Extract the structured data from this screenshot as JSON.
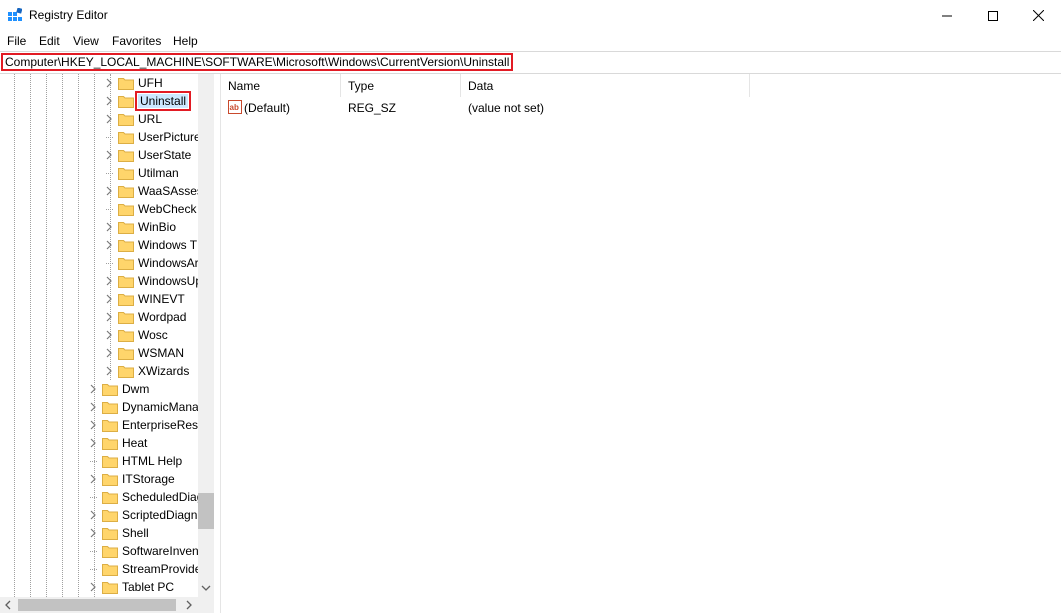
{
  "window": {
    "title": "Registry Editor",
    "controls": {
      "minimize": "minimize-icon",
      "maximize": "maximize-icon",
      "close": "close-icon"
    }
  },
  "menu": [
    "File",
    "Edit",
    "View",
    "Favorites",
    "Help"
  ],
  "address": "Computer\\HKEY_LOCAL_MACHINE\\SOFTWARE\\Microsoft\\Windows\\CurrentVersion\\Uninstall",
  "tree": {
    "deep_nodes": [
      {
        "label": "UFH",
        "expandable": true
      },
      {
        "label": "Uninstall",
        "expandable": true,
        "selected": true
      },
      {
        "label": "URL",
        "expandable": true
      },
      {
        "label": "UserPicture",
        "expandable": false
      },
      {
        "label": "UserState",
        "expandable": true
      },
      {
        "label": "Utilman",
        "expandable": false
      },
      {
        "label": "WaaSAsses",
        "expandable": true
      },
      {
        "label": "WebCheck",
        "expandable": false
      },
      {
        "label": "WinBio",
        "expandable": true
      },
      {
        "label": "Windows T",
        "expandable": true
      },
      {
        "label": "WindowsAr",
        "expandable": false
      },
      {
        "label": "WindowsUp",
        "expandable": true
      },
      {
        "label": "WINEVT",
        "expandable": true
      },
      {
        "label": "Wordpad",
        "expandable": true
      },
      {
        "label": "Wosc",
        "expandable": true
      },
      {
        "label": "WSMAN",
        "expandable": true
      },
      {
        "label": "XWizards",
        "expandable": true
      }
    ],
    "shallow_nodes": [
      {
        "label": "Dwm",
        "expandable": true
      },
      {
        "label": "DynamicMana",
        "expandable": true
      },
      {
        "label": "EnterpriseReso",
        "expandable": true
      },
      {
        "label": "Heat",
        "expandable": true
      },
      {
        "label": "HTML Help",
        "expandable": false
      },
      {
        "label": "ITStorage",
        "expandable": true
      },
      {
        "label": "ScheduledDiag",
        "expandable": false
      },
      {
        "label": "ScriptedDiagn",
        "expandable": true
      },
      {
        "label": "Shell",
        "expandable": true
      },
      {
        "label": "SoftwareInven",
        "expandable": false
      },
      {
        "label": "StreamProvide",
        "expandable": false
      },
      {
        "label": "Tablet PC",
        "expandable": true
      }
    ]
  },
  "list": {
    "columns": [
      "Name",
      "Type",
      "Data"
    ],
    "rows": [
      {
        "icon": "string-value-icon",
        "name": "(Default)",
        "type": "REG_SZ",
        "data": "(value not set)"
      }
    ]
  },
  "colors": {
    "highlight": "#e21b24",
    "selection": "#cce8ff",
    "folder": "#ffd56b"
  }
}
